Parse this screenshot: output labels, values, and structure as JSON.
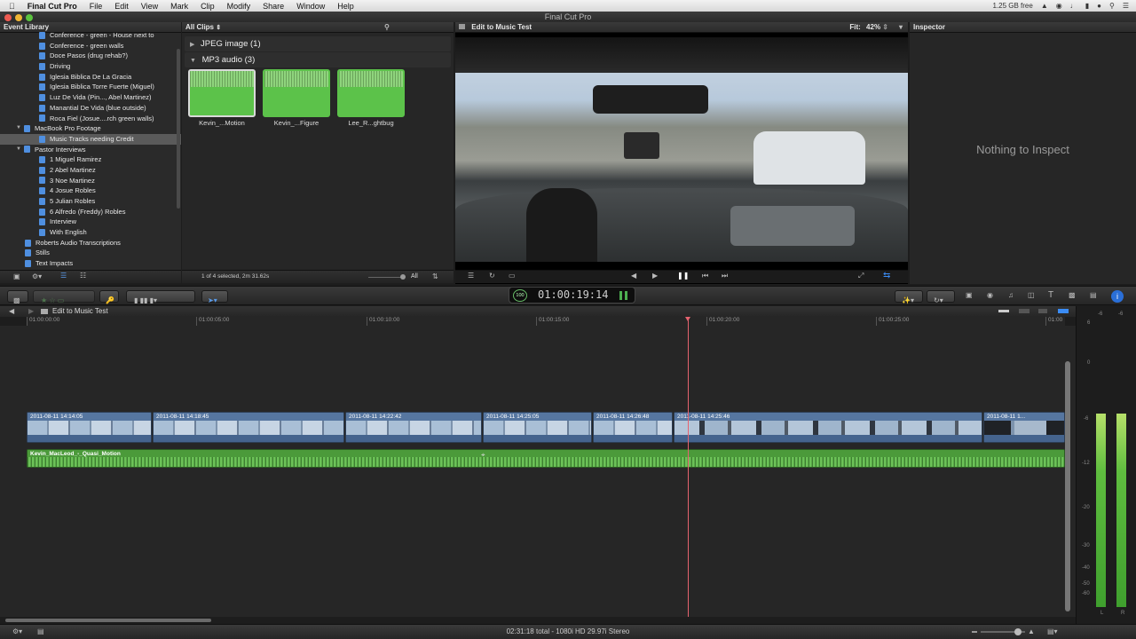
{
  "menubar": {
    "app": "Final Cut Pro",
    "items": [
      "File",
      "Edit",
      "View",
      "Mark",
      "Clip",
      "Modify",
      "Share",
      "Window",
      "Help"
    ],
    "tray_text": "1.25 GB free"
  },
  "window_title": "Final Cut Pro",
  "library": {
    "title": "Event Library",
    "items": [
      {
        "label": "Conference - green - House next to",
        "indent": 2
      },
      {
        "label": "Conference - green walls",
        "indent": 2
      },
      {
        "label": "Doce Pasos (drug rehab?)",
        "indent": 2
      },
      {
        "label": "Driving",
        "indent": 2
      },
      {
        "label": "Iglesia Biblica De La Gracia",
        "indent": 2
      },
      {
        "label": "Iglesia Biblica Torre Fuerte (Miguel)",
        "indent": 2
      },
      {
        "label": "Luz De Vida (Pin..., Abel Martinez)",
        "indent": 2
      },
      {
        "label": "Manantial De Vida (blue outside)",
        "indent": 2
      },
      {
        "label": "Roca Fiel (Josue....rch green walls)",
        "indent": 2
      },
      {
        "label": "MacBook Pro Footage",
        "indent": 1,
        "expanded": true
      },
      {
        "label": "Music Tracks needing Credit",
        "indent": 2,
        "selected": true
      },
      {
        "label": "Pastor Interviews",
        "indent": 1,
        "expanded": true
      },
      {
        "label": "1 Miguel Ramirez",
        "indent": 2
      },
      {
        "label": "2 Abel Martinez",
        "indent": 2
      },
      {
        "label": "3 Noe Martinez",
        "indent": 2
      },
      {
        "label": "4 Josue Robles",
        "indent": 2
      },
      {
        "label": "5 Julian Robles",
        "indent": 2
      },
      {
        "label": "6 Alfredo (Freddy) Robles",
        "indent": 2
      },
      {
        "label": "Interview",
        "indent": 2
      },
      {
        "label": "With English",
        "indent": 2
      },
      {
        "label": "Roberts Audio Transcriptions",
        "indent": 1
      },
      {
        "label": "Stills",
        "indent": 1
      },
      {
        "label": "Text Impacts",
        "indent": 1
      }
    ]
  },
  "browser": {
    "filter_label": "All Clips",
    "groups": [
      {
        "label": "JPEG image  (1)",
        "expanded": false
      },
      {
        "label": "MP3 audio  (3)",
        "expanded": true
      }
    ],
    "clips": [
      {
        "label": "Kevin_...Motion",
        "selected": true
      },
      {
        "label": "Kevin_...Figure",
        "selected": false
      },
      {
        "label": "Lee_R...ghtbug",
        "selected": false
      }
    ],
    "status": "1 of 4 selected, 2m 31.62s",
    "all_label": "All"
  },
  "viewer": {
    "title": "Edit to Music Test",
    "fit_label": "Fit:",
    "zoom": "42%"
  },
  "inspector": {
    "title": "Inspector",
    "empty_text": "Nothing to Inspect"
  },
  "timecode": {
    "value": "01:00:19:14",
    "percent_label": "100"
  },
  "timeline": {
    "project_title": "Edit to Music Test",
    "ruler_labels": [
      "01:00:00:00",
      "01:00:05:00",
      "01:00:10:00",
      "01:00:15:00",
      "01:00:20:00",
      "01:00:25:00",
      "01:00"
    ],
    "clips": [
      {
        "label": "2011-08-11 14:14:05"
      },
      {
        "label": "2011-08-11 14:18:45"
      },
      {
        "label": "2011-08-11 14:22:42"
      },
      {
        "label": "2011-08-11 14:25:05"
      },
      {
        "label": "2011-08-11 14:26:48"
      },
      {
        "label": "2011-08-11 14:25:46"
      },
      {
        "label": "2011-08-11 1..."
      }
    ],
    "music_clip": "Kevin_MacLeod_-_Quasi_Motion"
  },
  "meters": {
    "scale": [
      "6",
      "0",
      "-6",
      "-12",
      "-20",
      "-30",
      "-40",
      "-50",
      "-60"
    ],
    "top_labels": [
      "-6",
      "-6"
    ],
    "channels": [
      "L",
      "R"
    ]
  },
  "status": "02:31:18 total - 1080i HD 29.97i Stereo",
  "colors": {
    "accent_blue": "#2a6fd8",
    "audio_green": "#5fb24c",
    "clip_blue": "#6f8fb5",
    "playhead": "#e5636f"
  }
}
